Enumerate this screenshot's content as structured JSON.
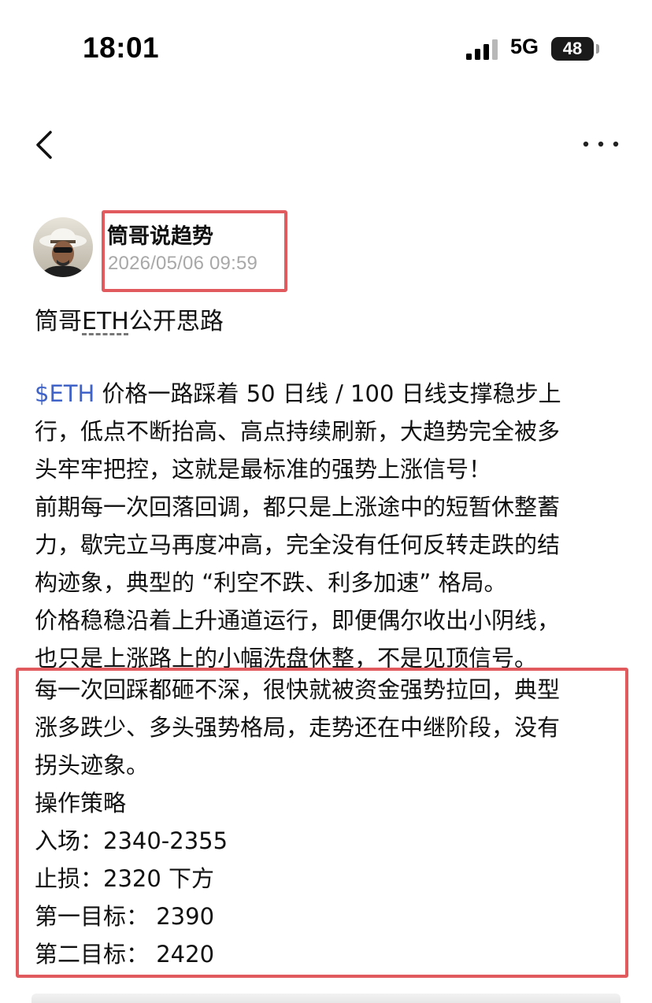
{
  "status_bar": {
    "time": "18:01",
    "network": "5G",
    "battery": "48",
    "signal_icon": "signal-bars-icon"
  },
  "nav": {
    "back_icon": "chevron-left-icon",
    "more_icon": "more-dots-icon"
  },
  "author": {
    "name": "筒哥说趋势",
    "timestamp": "2026/05/06 09:59"
  },
  "highlight_color": "#e05a5e",
  "post": {
    "title_prefix": "筒哥",
    "title_eth": "ETH",
    "title_suffix": "公开思路",
    "ticker": "$ETH",
    "ticker_color": "#3f63c9",
    "lines": [
      " 价格一路踩着 50 日线 / 100 日线支撑稳步上",
      "行，低点不断抬高、高点持续刷新，大趋势完全被多",
      "头牢牢把控，这就是最标准的强势上涨信号！",
      "前期每一次回落回调，都只是上涨途中的短暂休整蓄",
      "力，歇完立马再度冲高，完全没有任何反转走跌的结",
      "构迹象，典型的 “利空不跌、利多加速” 格局。",
      "价格稳稳沿着上升通道运行，即便偶尔收出小阴线，",
      "也只是上涨路上的小幅洗盘休整，不是见顶信号。"
    ],
    "highlighted_lines": [
      "每一次回踩都砸不深，很快就被资金强势拉回，典型",
      "涨多跌少、多头强势格局，走势还在中继阶段，没有",
      "拐头迹象。",
      "操作策略",
      "入场：2340-2355",
      "止损：2320 下方",
      "第一目标： 2390",
      "第二目标： 2420"
    ]
  }
}
